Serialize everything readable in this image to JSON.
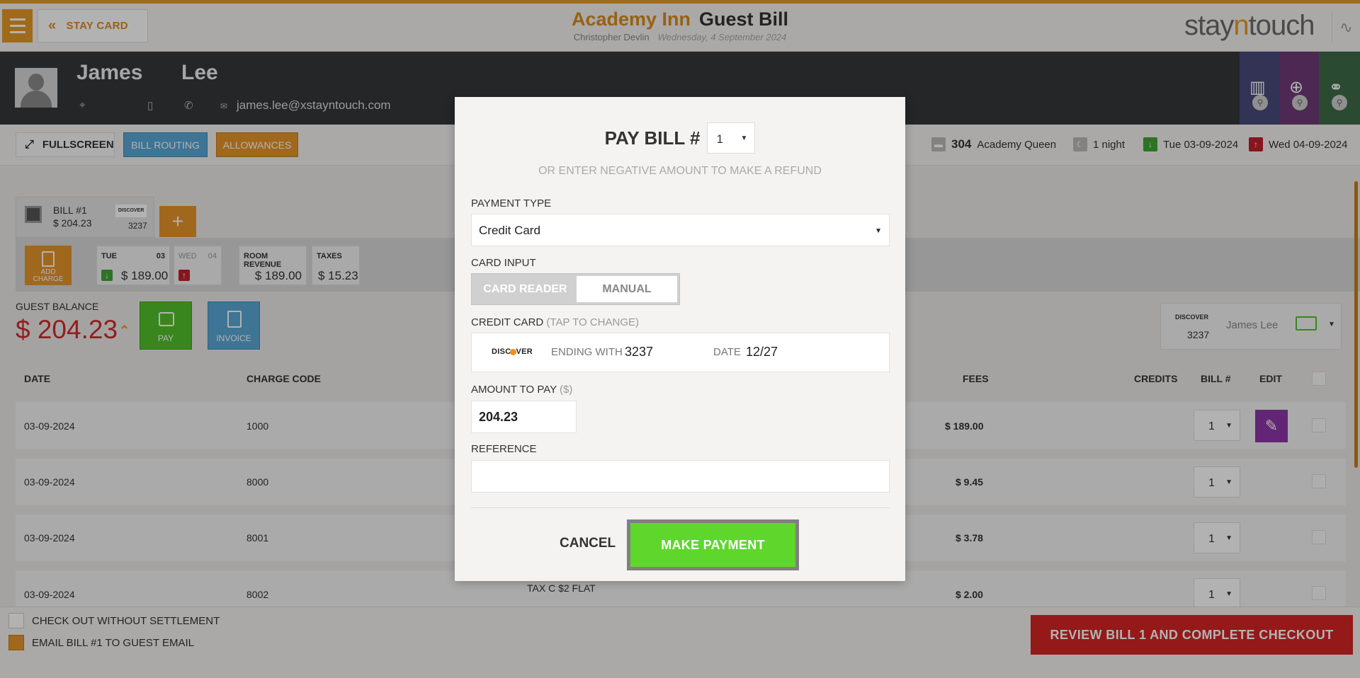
{
  "header": {
    "stay_card_label": "STAY CARD",
    "hotel_name": "Academy Inn",
    "page_title": "Guest Bill",
    "user_name": "Christopher Devlin",
    "date": "Wednesday, 4 September 2024",
    "brand_pre": "stay",
    "brand_mid": "n",
    "brand_post": "touch"
  },
  "guest": {
    "first_name": "James",
    "last_name": "Lee",
    "email": "james.lee@xstayntouch.com"
  },
  "toolbar": {
    "fullscreen_label": "FULLSCREEN",
    "bill_routing_label": "BILL ROUTING",
    "allowances_label": "ALLOWANCES"
  },
  "reservation": {
    "room_number": "304",
    "room_type": "Academy Queen",
    "nights": "1 night",
    "arrival": "Tue 03-09-2024",
    "departure": "Wed 04-09-2024"
  },
  "bill_tab": {
    "label": "BILL #1",
    "amount": "$ 204.23",
    "card_brand": "DISCOVER",
    "card_last4": "3237"
  },
  "summary": {
    "add_charge_label": "ADD CHARGE",
    "day1_label": "TUE",
    "day1_num": "03",
    "day1_amount": "$ 189.00",
    "day2_label": "WED",
    "day2_num": "04",
    "room_revenue_label": "ROOM REVENUE",
    "room_revenue": "$ 189.00",
    "taxes_label": "TAXES",
    "taxes": "$ 15.23"
  },
  "balance": {
    "label": "GUEST BALANCE",
    "value": "$ 204.23",
    "pay_label": "PAY",
    "invoice_label": "INVOICE"
  },
  "card_selector": {
    "brand": "DISCOVER",
    "last4": "3237",
    "holder": "James Lee"
  },
  "table": {
    "headers": {
      "date": "DATE",
      "charge_code": "CHARGE CODE",
      "fees": "FEES",
      "credits": "CREDITS",
      "bill": "BILL #",
      "edit": "EDIT"
    },
    "rows": [
      {
        "date": "03-09-2024",
        "code": "1000",
        "desc": "",
        "fees": "$ 189.00",
        "bill": "1"
      },
      {
        "date": "03-09-2024",
        "code": "8000",
        "desc": "",
        "fees": "$ 9.45",
        "bill": "1"
      },
      {
        "date": "03-09-2024",
        "code": "8001",
        "desc": "",
        "fees": "$ 3.78",
        "bill": "1"
      },
      {
        "date": "03-09-2024",
        "code": "8002",
        "desc": "TAX C $2 FLAT",
        "fees": "$ 2.00",
        "bill": "1"
      }
    ]
  },
  "footer": {
    "checkout_without_settlement": "CHECK OUT WITHOUT SETTLEMENT",
    "email_bill": "EMAIL BILL #1 TO GUEST EMAIL",
    "review_button": "REVIEW BILL 1 AND COMPLETE CHECKOUT"
  },
  "modal": {
    "title": "PAY BILL #",
    "bill_number": "1",
    "hint": "OR ENTER NEGATIVE AMOUNT TO MAKE A REFUND",
    "payment_type_label": "PAYMENT TYPE",
    "payment_type_value": "Credit Card",
    "card_input_label": "CARD INPUT",
    "card_reader_label": "CARD READER",
    "manual_label": "MANUAL",
    "credit_card_label": "CREDIT CARD",
    "credit_card_hint": "(TAP TO CHANGE)",
    "card_brand": "DISCOVER",
    "ending_with_label": "ENDING WITH",
    "card_last4": "3237",
    "date_label": "DATE",
    "card_expiry": "12/27",
    "amount_label": "AMOUNT TO PAY",
    "amount_unit": "($)",
    "amount_value": "204.23",
    "reference_label": "REFERENCE",
    "reference_value": "",
    "cancel_label": "CANCEL",
    "make_payment_label": "MAKE PAYMENT"
  },
  "colors": {
    "accent_orange": "#e59a2a",
    "balance_red": "#d02b2b",
    "pay_green": "#5fd62c",
    "edit_purple": "#8f36a8"
  }
}
